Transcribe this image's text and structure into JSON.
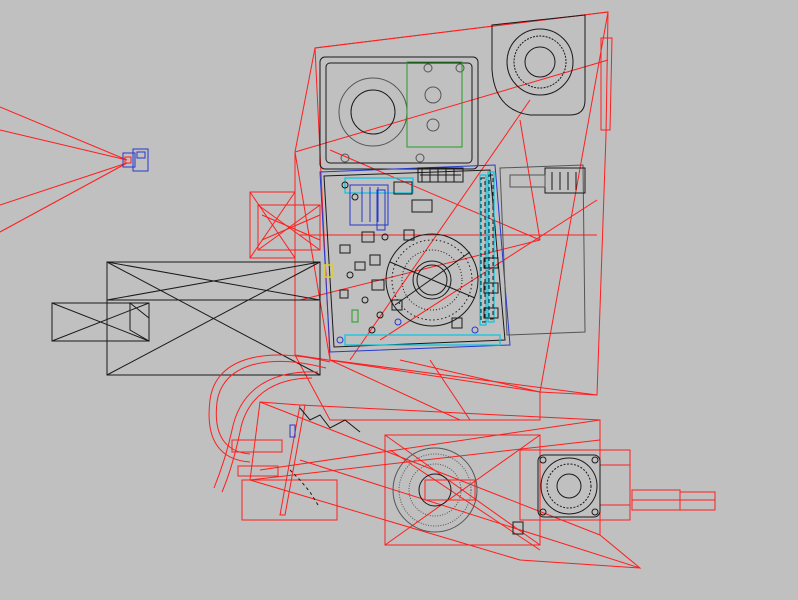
{
  "viewport": {
    "background": "#c0c0c0",
    "render_mode": "wireframe"
  },
  "palette": {
    "case": "#ff1e1e",
    "component": "#1a1a1a",
    "camera": "#2838d0",
    "ram_highlight": "#00c8e6",
    "drive_board": "#1fa01f",
    "connector": "#e0d020"
  },
  "objects": [
    {
      "name": "camera",
      "icon": "camera-icon"
    },
    {
      "name": "computer-case"
    },
    {
      "name": "hard-drive"
    },
    {
      "name": "blower-fan"
    },
    {
      "name": "motherboard"
    },
    {
      "name": "cpu-cooler"
    },
    {
      "name": "ram-slots"
    },
    {
      "name": "psu-box"
    },
    {
      "name": "power-cable"
    },
    {
      "name": "graphics-card"
    },
    {
      "name": "gpu-heatsink"
    },
    {
      "name": "gpu-fan"
    }
  ]
}
